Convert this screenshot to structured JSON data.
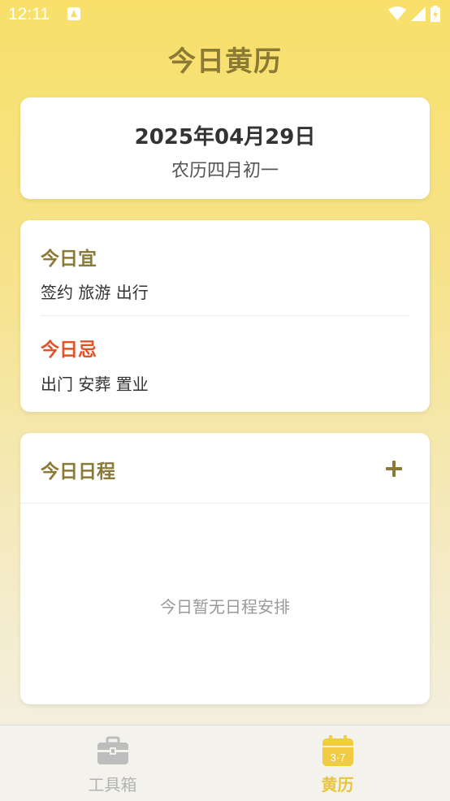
{
  "status_bar": {
    "time": "12:11"
  },
  "header": {
    "title": "今日黄历"
  },
  "date_card": {
    "date": "2025年04月29日",
    "lunar": "农历四月初一"
  },
  "almanac": {
    "yi_title": "今日宜",
    "yi_items": "签约 旅游 出行",
    "ji_title": "今日忌",
    "ji_items": "出门 安葬 置业",
    "colors": {
      "yi": "#8a7a34",
      "ji": "#e0532a"
    }
  },
  "schedule": {
    "title": "今日日程",
    "empty_text": "今日暂无日程安排",
    "add_icon": "plus-icon"
  },
  "bottom_nav": {
    "items": [
      {
        "label": "工具箱",
        "icon": "toolbox-icon",
        "active": false
      },
      {
        "label": "黄历",
        "icon": "calendar-icon",
        "icon_text": "3·7",
        "active": true
      }
    ]
  },
  "colors": {
    "accent": "#8a7a34",
    "active_tab": "#e8c53a"
  }
}
